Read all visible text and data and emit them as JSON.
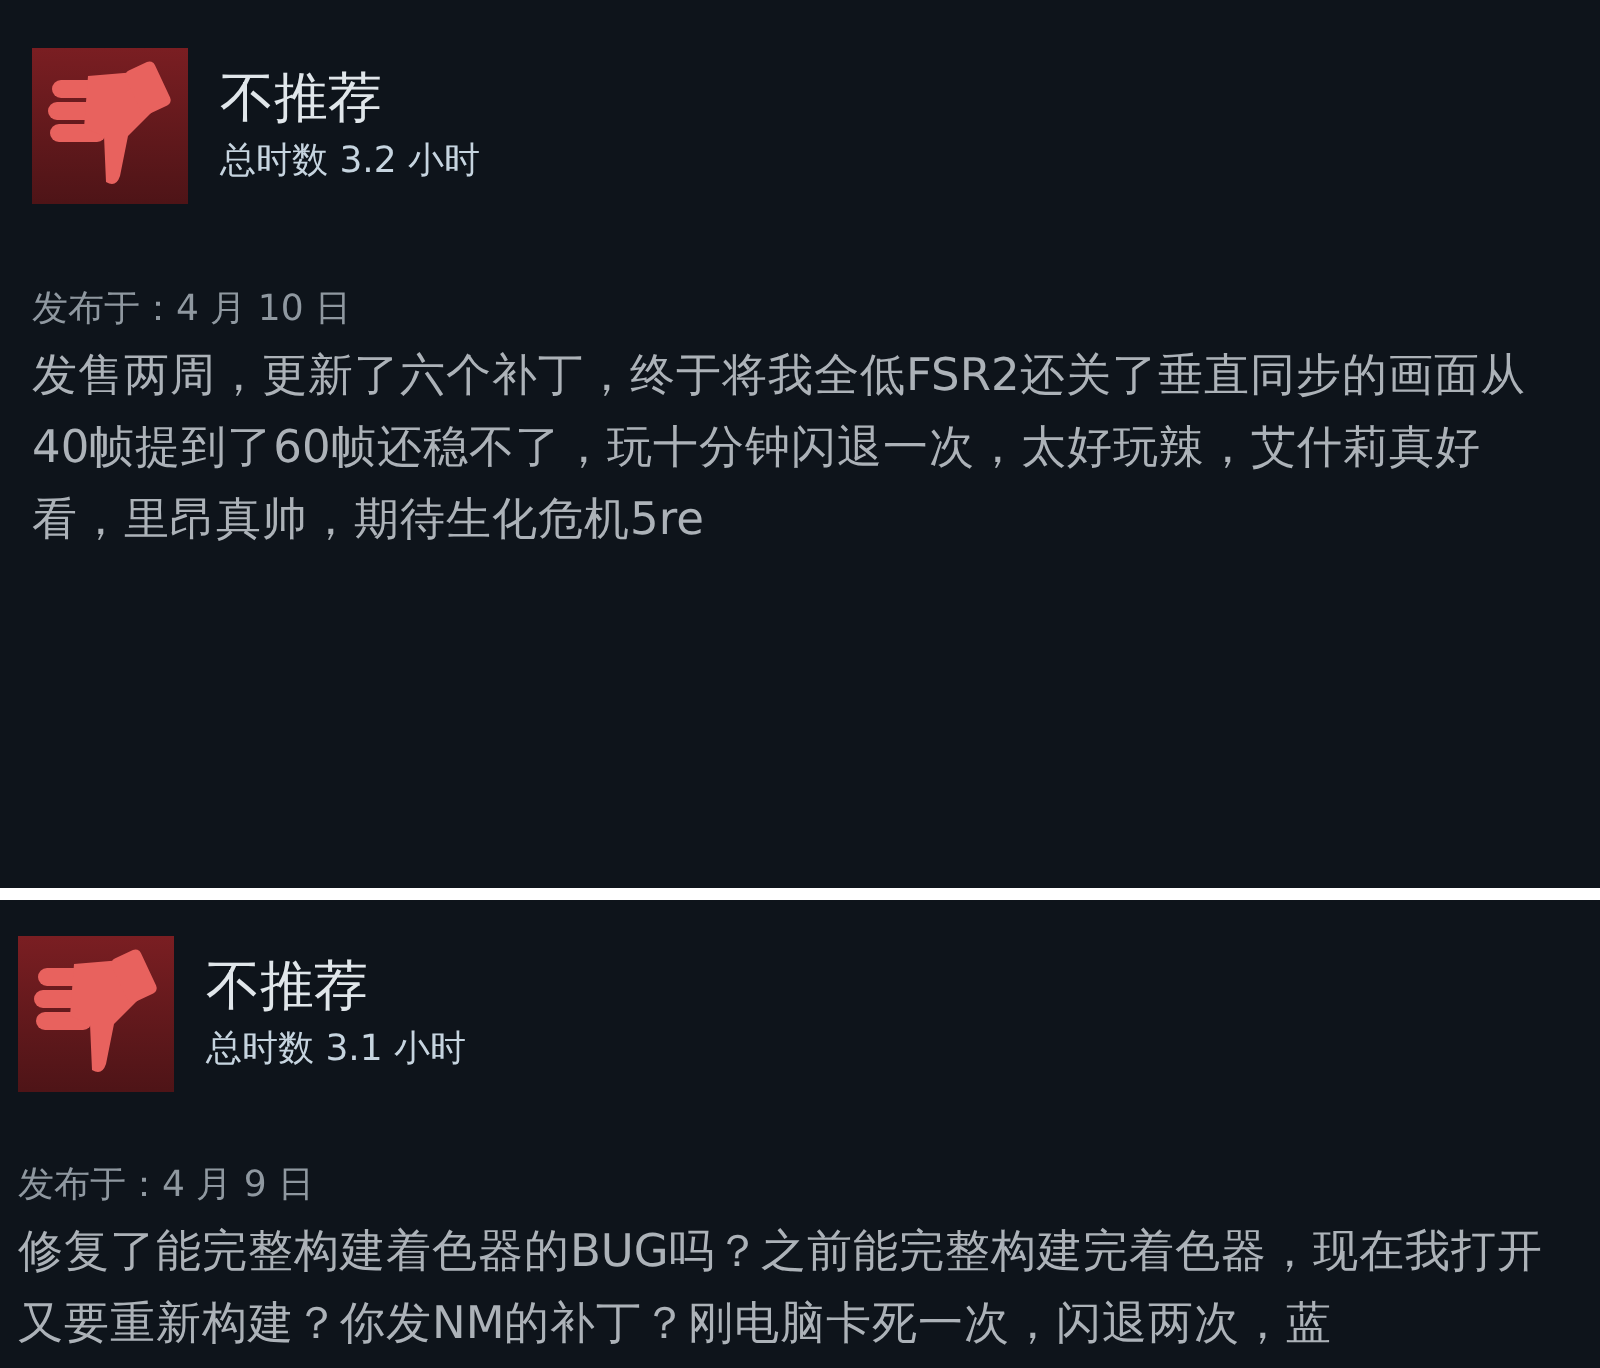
{
  "reviews": [
    {
      "verdict": "不推荐",
      "recommended": false,
      "hours": "总时数 3.2 小时",
      "posted": "发布于：4 月 10 日",
      "body": "发售两周，更新了六个补丁，终于将我全低FSR2还关了垂直同步的画面从40帧提到了60帧还稳不了，玩十分钟闪退一次，太好玩辣，艾什莉真好看，里昂真帅，期待生化危机5re"
    },
    {
      "verdict": "不推荐",
      "recommended": false,
      "hours": "总时数 3.1 小时",
      "posted": "发布于：4 月 9 日",
      "body": "修复了能完整构建着色器的BUG吗？之前能完整构建完着色器，现在我打开又要重新构建？你发NM的补丁？刚电脑卡死一次，闪退两次，蓝"
    }
  ]
}
